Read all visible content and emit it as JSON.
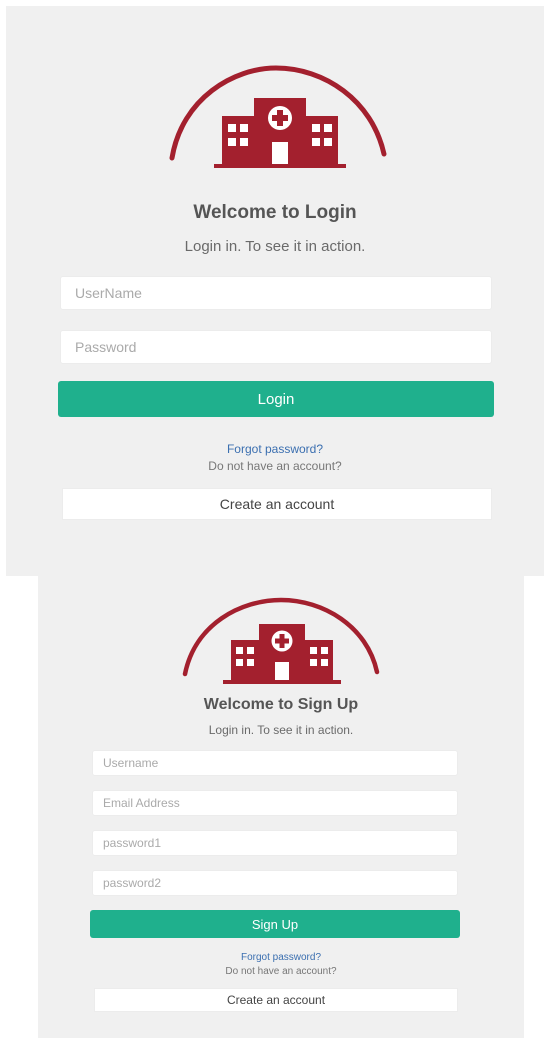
{
  "login": {
    "logo_icon": "hospital-icon",
    "brand_color": "#a3202e",
    "title": "Welcome to Login",
    "subtitle": "Login in. To see it in action.",
    "username_placeholder": "UserName",
    "password_placeholder": "Password",
    "submit_label": "Login",
    "forgot_label": "Forgot password?",
    "no_account_label": "Do not have an account?",
    "create_account_label": "Create an account"
  },
  "signup": {
    "logo_icon": "hospital-icon",
    "brand_color": "#a3202e",
    "title": "Welcome to Sign Up",
    "subtitle": "Login in. To see it in action.",
    "username_placeholder": "Username",
    "email_placeholder": "Email Address",
    "password1_placeholder": "password1",
    "password2_placeholder": "password2",
    "submit_label": "Sign Up",
    "forgot_label": "Forgot password?",
    "no_account_label": "Do not have an account?",
    "create_account_label": "Create an account"
  },
  "accent_color": "#1fb08d",
  "link_color": "#3b6fb0"
}
